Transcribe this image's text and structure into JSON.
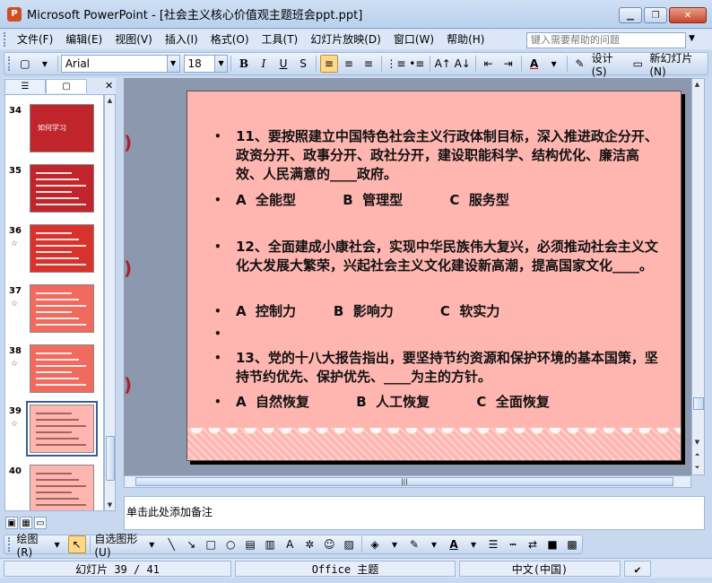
{
  "window": {
    "title": "Microsoft PowerPoint - [社会主义核心价值观主题班会ppt.ppt]",
    "minimize": "▁",
    "restore": "❐",
    "close": "✕"
  },
  "menu": {
    "items": [
      "文件(F)",
      "编辑(E)",
      "视图(V)",
      "插入(I)",
      "格式(O)",
      "工具(T)",
      "幻灯片放映(D)",
      "窗口(W)",
      "帮助(H)"
    ],
    "help_placeholder": "键入需要帮助的问题"
  },
  "toolbar": {
    "font": "Arial",
    "size": "18",
    "bold": "B",
    "italic": "I",
    "underline": "U",
    "design": "设计(S)",
    "new_slide": "新幻灯片(N)"
  },
  "thumbnails": [
    {
      "num": "34",
      "star": false,
      "color": "#c0252c",
      "text": "如何学习"
    },
    {
      "num": "35",
      "star": false,
      "color": "#c0252c",
      "text": ""
    },
    {
      "num": "36",
      "star": true,
      "color": "#d8322c",
      "text": ""
    },
    {
      "num": "37",
      "star": true,
      "color": "#f06a5e",
      "text": ""
    },
    {
      "num": "38",
      "star": true,
      "color": "#f06a5e",
      "text": ""
    },
    {
      "num": "39",
      "star": true,
      "color": "#ffb6b1",
      "text": "",
      "selected": true
    },
    {
      "num": "40",
      "star": false,
      "color": "#ffb6b1",
      "text": ""
    }
  ],
  "slide": {
    "bullets": [
      {
        "text": "11、要按照建立中国特色社会主义行政体制目标，深入推进政企分开、政资分开、政事分开、政社分开，建设职能科学、结构优化、廉洁高效、人民满意的____政府。"
      },
      {
        "text": "A  全能型          B  管理型          C  服务型"
      },
      {
        "text": "12、全面建成小康社会，实现中华民族伟大复兴，必须推动社会主义文化大发展大繁荣，兴起社会主义文化建设新高潮，提高国家文化____。"
      },
      {
        "text": "A  控制力        B  影响力          C  软实力"
      },
      {
        "text": ""
      },
      {
        "text": "13、党的十八大报告指出，要坚持节约资源和保护环境的基本国策，坚持节约优先、保护优先、____为主的方针。"
      },
      {
        "text": "A  自然恢复          B  人工恢复          C  全面恢复"
      }
    ]
  },
  "notes": {
    "placeholder": "单击此处添加备注"
  },
  "drawbar": {
    "draw": "绘图(R)",
    "autoshapes": "自选图形(U)"
  },
  "status": {
    "slide": "幻灯片 39 / 41",
    "theme": "Office 主题",
    "lang": "中文(中国)"
  }
}
